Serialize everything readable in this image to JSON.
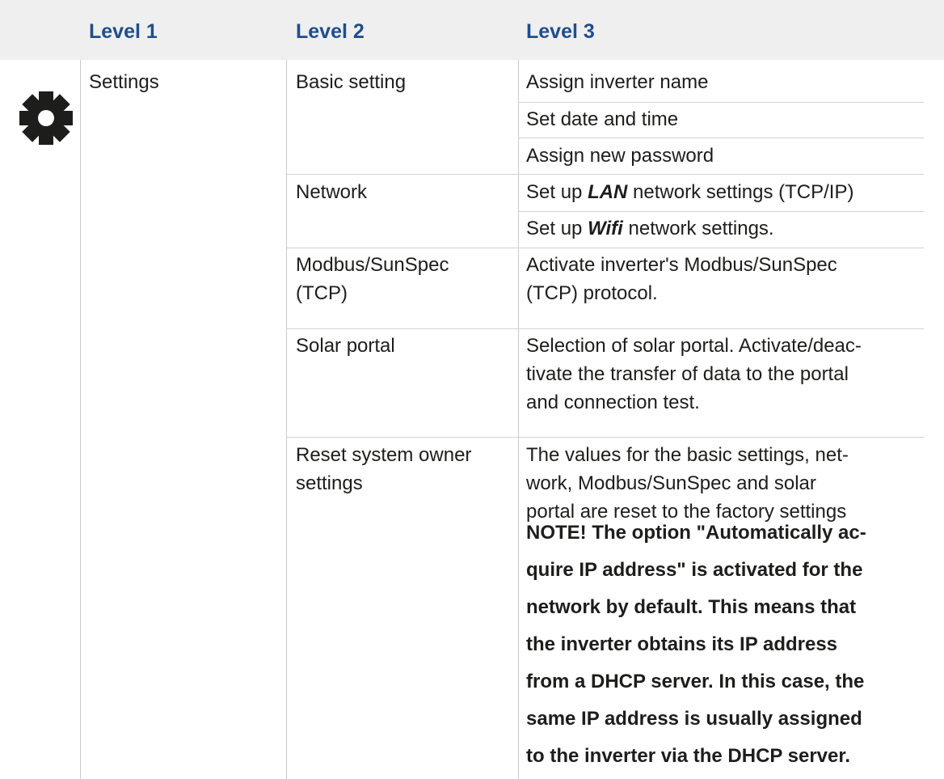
{
  "header": {
    "level1": "Level 1",
    "level2": "Level 2",
    "level3": "Level 3"
  },
  "icon": "gear-icon",
  "colors": {
    "header_bg": "#efefef",
    "header_text": "#1f4e8c",
    "rule": "#d2d2d2"
  },
  "level1": {
    "label": "Settings"
  },
  "level2": {
    "basic": "Basic setting",
    "network": "Network",
    "modbus": [
      "Modbus/SunSpec",
      "(TCP)"
    ],
    "solar": "Solar portal",
    "reset": [
      "Reset system owner",
      "settings"
    ]
  },
  "level3": {
    "assign_name": "Assign inverter name",
    "set_date": "Set date and time",
    "assign_password": "Assign new password",
    "lan": {
      "pre": "Set up ",
      "em": "LAN",
      "post": " network settings (TCP/IP)"
    },
    "wifi": {
      "pre": "Set up ",
      "em": "Wifi",
      "post": " network settings."
    },
    "modbus": [
      "Activate inverter's Modbus/SunSpec",
      "(TCP) protocol."
    ],
    "solar": [
      "Selection of solar portal. Activate/deac-",
      "tivate the transfer of data to the portal",
      "and connection test."
    ],
    "reset": [
      "The values for the basic settings, net-",
      "work, Modbus/SunSpec and solar",
      "portal are reset to the factory settings"
    ],
    "note": [
      "NOTE! The option \"Automatically ac-",
      "quire IP address\" is activated for the",
      "network by default. This means that",
      "the inverter obtains its IP address",
      "from a DHCP server. In this case, the",
      "same IP address is usually assigned",
      "to the inverter via the DHCP server."
    ]
  }
}
